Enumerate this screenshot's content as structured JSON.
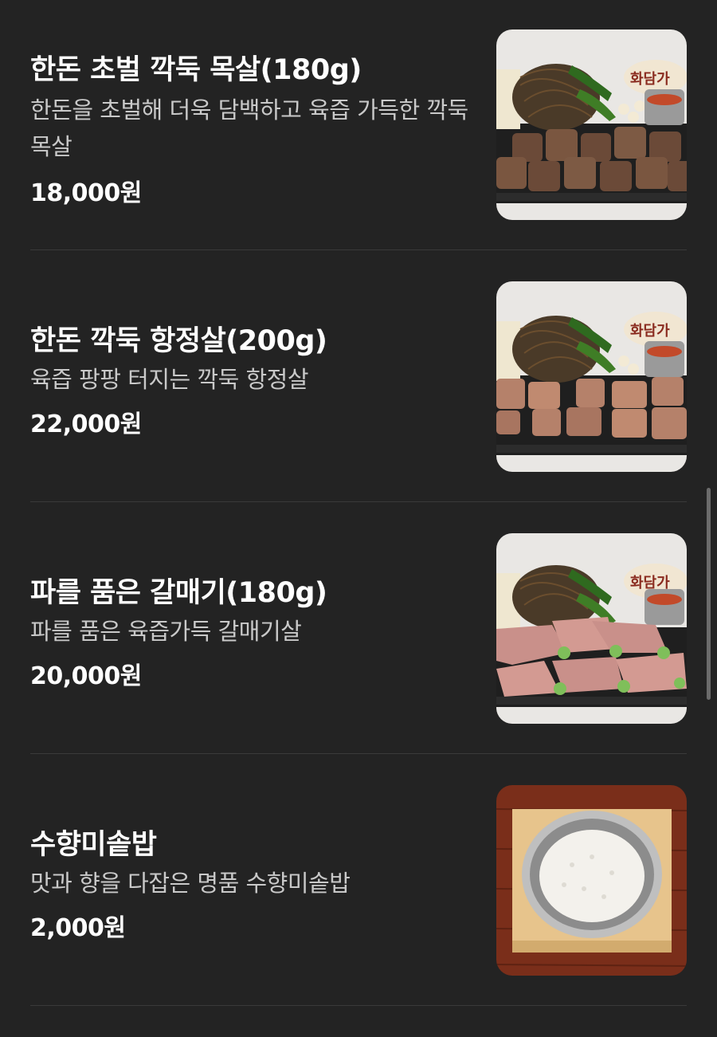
{
  "menu": {
    "items": [
      {
        "title": "한돈 초벌 깍둑 목살(180g)",
        "description": "한돈을 초벌해 더욱 담백하고 육즙 가득한 깍둑 목살",
        "price": "18,000원"
      },
      {
        "title": "한돈 깍둑 항정살(200g)",
        "description": "육즙 팡팡 터지는 깍둑 항정살",
        "price": "22,000원"
      },
      {
        "title": "파를 품은 갈매기(180g)",
        "description": "파를 품은 육즙가득 갈매기살",
        "price": "20,000원"
      },
      {
        "title": "수향미솥밥",
        "description": "맛과 향을 다잡은 명품 수향미솥밥",
        "price": "2,000원"
      }
    ]
  },
  "logo_text": "화담가",
  "colors": {
    "background": "#232323",
    "divider": "#3a3a3a",
    "description": "#c9c9c9",
    "scrollbar": "#6b6b6b"
  }
}
